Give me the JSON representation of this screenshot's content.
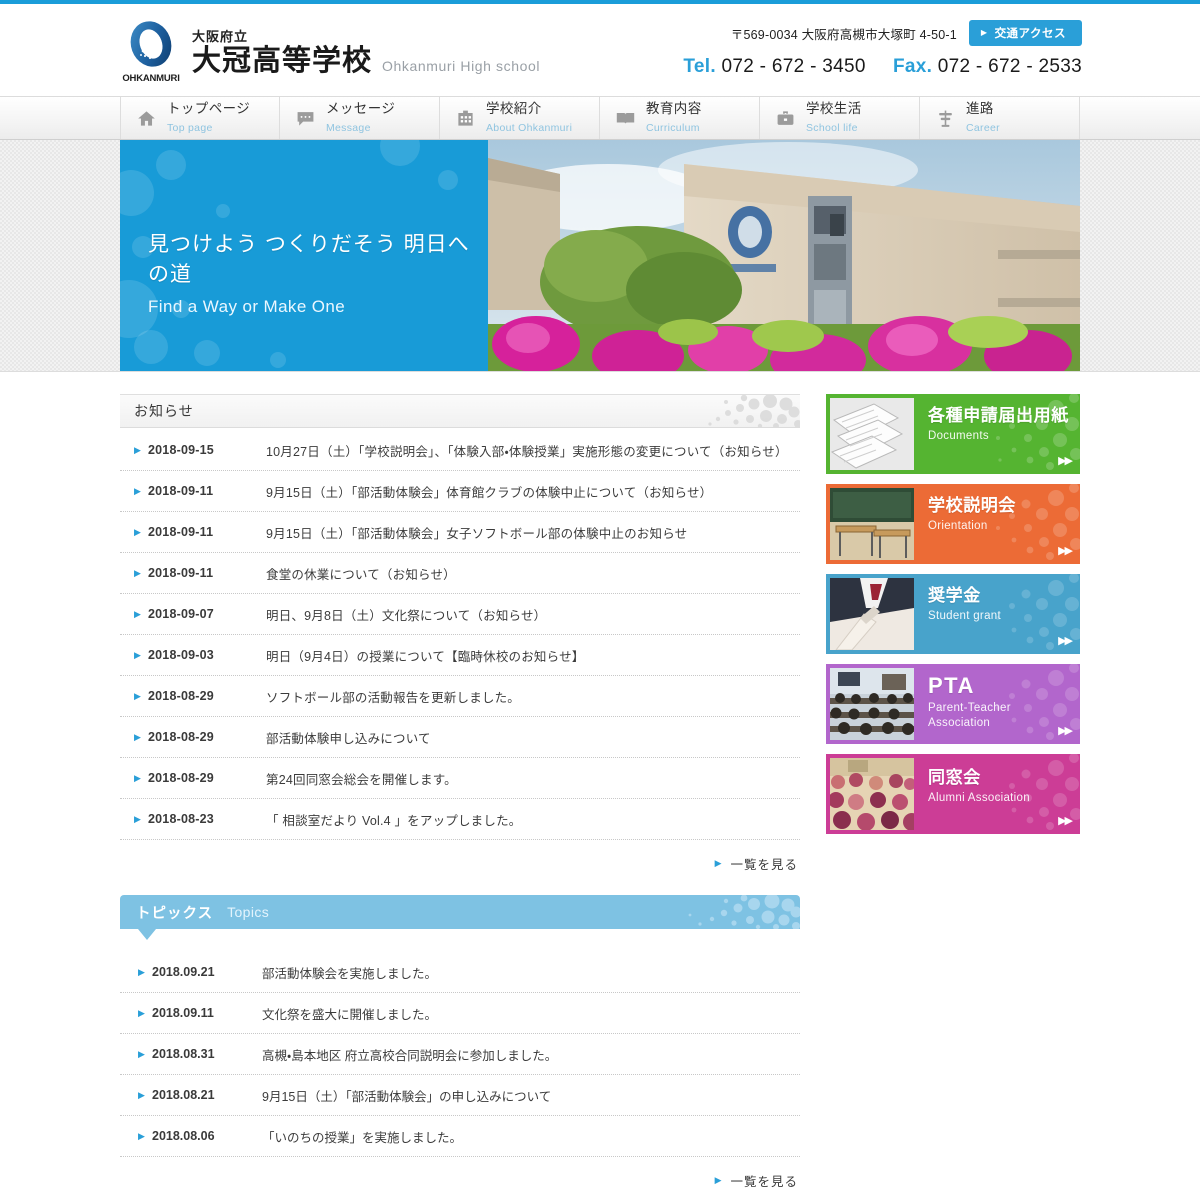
{
  "site": {
    "prefecture_label": "大阪府立",
    "school_name_jp": "大冠高等学校",
    "school_name_en": "Ohkanmuri High school",
    "logo_word": "OHKANMURI"
  },
  "header": {
    "address": "〒569-0034 大阪府高槻市大塚町 4-50-1",
    "access_button": "交通アクセス",
    "tel_label": "Tel.",
    "tel_number": "072 - 672 - 3450",
    "fax_label": "Fax.",
    "fax_number": "072 - 672 - 2533"
  },
  "nav": {
    "items": [
      {
        "jp": "トップページ",
        "en": "Top page",
        "icon": "home-icon"
      },
      {
        "jp": "メッセージ",
        "en": "Message",
        "icon": "speech-bubble-icon"
      },
      {
        "jp": "学校紹介",
        "en": "About Ohkanmuri",
        "icon": "building-icon"
      },
      {
        "jp": "教育内容",
        "en": "Curriculum",
        "icon": "open-book-icon"
      },
      {
        "jp": "学校生活",
        "en": "School life",
        "icon": "briefcase-icon"
      },
      {
        "jp": "進路",
        "en": "Career",
        "icon": "signpost-icon"
      }
    ]
  },
  "hero": {
    "slogan_jp": "見つけよう つくりだそう 明日への道",
    "slogan_en": "Find a Way or Make One",
    "panel_color": "#189bd7"
  },
  "news": {
    "heading": "お知らせ",
    "more_label": "一覧を見る",
    "items": [
      {
        "date": "2018-09-15",
        "title": "10月27日（土）「学校説明会」、「体験入部・体験授業」実施形態の変更について（お知らせ）"
      },
      {
        "date": "2018-09-11",
        "title": "9月15日（土）「部活動体験会」体育館クラブの体験中止について（お知らせ）"
      },
      {
        "date": "2018-09-11",
        "title": "9月15日（土）「部活動体験会」女子ソフトボール部の体験中止のお知らせ"
      },
      {
        "date": "2018-09-11",
        "title": "食堂の休業について（お知らせ）"
      },
      {
        "date": "2018-09-07",
        "title": "明日、9月8日（土）文化祭について（お知らせ）"
      },
      {
        "date": "2018-09-03",
        "title": "明日（9月4日）の授業について【臨時休校のお知らせ】"
      },
      {
        "date": "2018-08-29",
        "title": "ソフトボール部の活動報告を更新しました。"
      },
      {
        "date": "2018-08-29",
        "title": "部活動体験申し込みについて"
      },
      {
        "date": "2018-08-29",
        "title": "第24回同窓会総会を開催します。"
      },
      {
        "date": "2018-08-23",
        "title": "「 相談室だより Vol.4 」をアップしました。"
      }
    ]
  },
  "topics": {
    "heading_jp": "トピックス",
    "heading_en": "Topics",
    "more_label": "一覧を見る",
    "items": [
      {
        "date": "2018.09.21",
        "title": "部活動体験会を実施しました。"
      },
      {
        "date": "2018.09.11",
        "title": "文化祭を盛大に開催しました。"
      },
      {
        "date": "2018.08.31",
        "title": "高槻・島本地区 府立高校合同説明会に参加しました。"
      },
      {
        "date": "2018.08.21",
        "title": "9月15日（土）「部活動体験会」の申し込みについて"
      },
      {
        "date": "2018.08.06",
        "title": "「いのちの授業」を実施しました。"
      }
    ]
  },
  "banners": [
    {
      "jp": "各種申請届出用紙",
      "en": "Documents",
      "color": "#55b431",
      "arrow": "▶▶"
    },
    {
      "jp": "学校説明会",
      "en": "Orientation",
      "color": "#ec6b36",
      "arrow": "▶▶"
    },
    {
      "jp": "奨学金",
      "en": "Student grant",
      "color": "#48a3cb",
      "arrow": "▶▶"
    },
    {
      "jp": "PTA",
      "en": "Parent-Teacher\nAssociation",
      "color": "#b266cc",
      "arrow": "▶▶"
    },
    {
      "jp": "同窓会",
      "en": "Alumni Association",
      "color": "#cc3d96",
      "arrow": "▶▶"
    }
  ]
}
